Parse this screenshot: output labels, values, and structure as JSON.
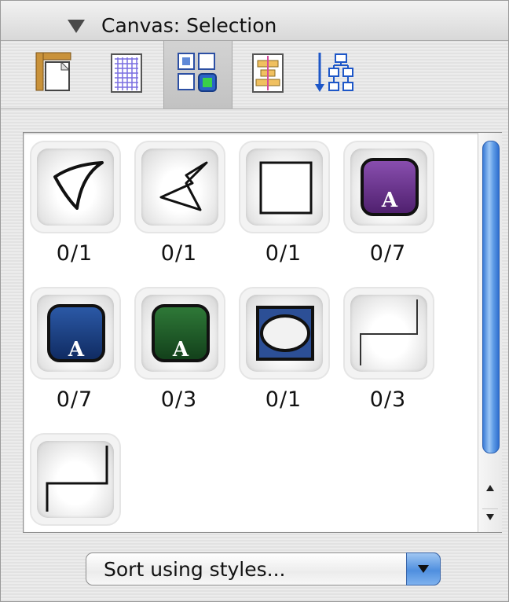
{
  "titlebar": {
    "title": "Canvas: Selection"
  },
  "toolbar": {
    "tools": [
      {
        "name": "ruler-page-icon"
      },
      {
        "name": "grid-page-icon"
      },
      {
        "name": "selection-styles-icon",
        "selected": true
      },
      {
        "name": "align-icon"
      },
      {
        "name": "hierarchy-icon"
      }
    ]
  },
  "styles_list": {
    "items": [
      {
        "icon": "curved-shape-icon",
        "count": "0/1"
      },
      {
        "icon": "polyline-shape-icon",
        "count": "0/1"
      },
      {
        "icon": "rectangle-shape-icon",
        "count": "0/1"
      },
      {
        "icon": "purple-text-box-icon",
        "glyph": "A",
        "count": "0/7"
      },
      {
        "icon": "blue-text-box-icon",
        "glyph": "A",
        "count": "0/7"
      },
      {
        "icon": "green-text-box-icon",
        "glyph": "A",
        "count": "0/3"
      },
      {
        "icon": "ellipse-shape-icon",
        "count": "0/1"
      },
      {
        "icon": "elbow-line-icon",
        "count": "0/3"
      },
      {
        "icon": "orthogonal-line-icon",
        "count": ""
      }
    ]
  },
  "sort_popup": {
    "label": "Sort using styles..."
  },
  "colors": {
    "purple": "#6a2f8f",
    "blue": "#1d3f7e",
    "green": "#1f5f2a",
    "accent": "#4f8fdf"
  }
}
